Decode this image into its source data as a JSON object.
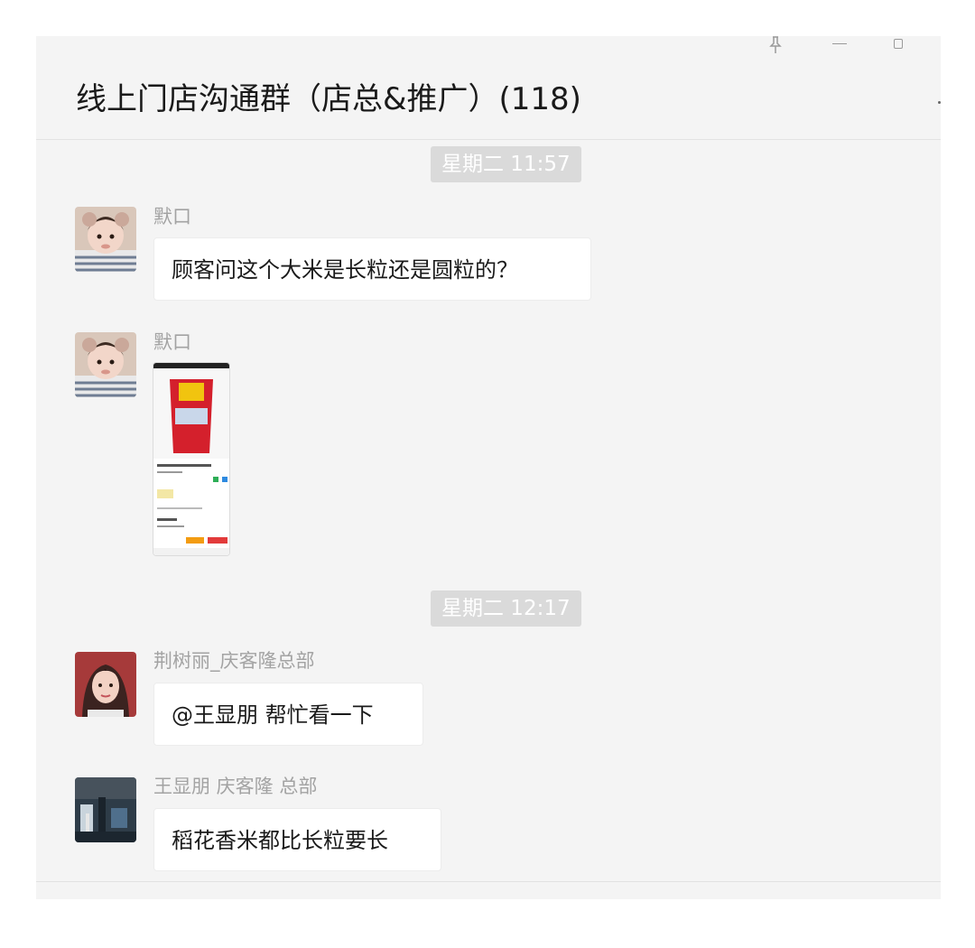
{
  "window": {
    "title": "线上门店沟通群（店总&推广）(118)",
    "controls": {
      "pin_icon": "pin-icon",
      "minimize_icon": "minimize-icon",
      "maximize_icon": "maximize-icon"
    }
  },
  "messages": [
    {
      "type": "timestamp",
      "text": "星期二 11:57"
    },
    {
      "type": "text",
      "sender": "默口",
      "avatar_icon": "baby-avatar",
      "text": "顾客问这个大米是长粒还是圆粒的？"
    },
    {
      "type": "image",
      "sender": "默口",
      "avatar_icon": "baby-avatar",
      "image_icon": "product-screenshot-thumbnail"
    },
    {
      "type": "timestamp",
      "text": "星期二 12:17"
    },
    {
      "type": "text",
      "sender": "荆树丽_庆客隆总部",
      "avatar_icon": "woman-avatar",
      "text": "@王显朋 帮忙看一下"
    },
    {
      "type": "text",
      "sender": "王显朋  庆客隆 总部",
      "avatar_icon": "photo-avatar",
      "text": "稻花香米都比长粒要长"
    }
  ],
  "colors": {
    "chat_background": "#f4f4f4",
    "bubble_background": "#ffffff",
    "timestamp_background": "#dadada",
    "sender_text": "#a3a3a3"
  }
}
